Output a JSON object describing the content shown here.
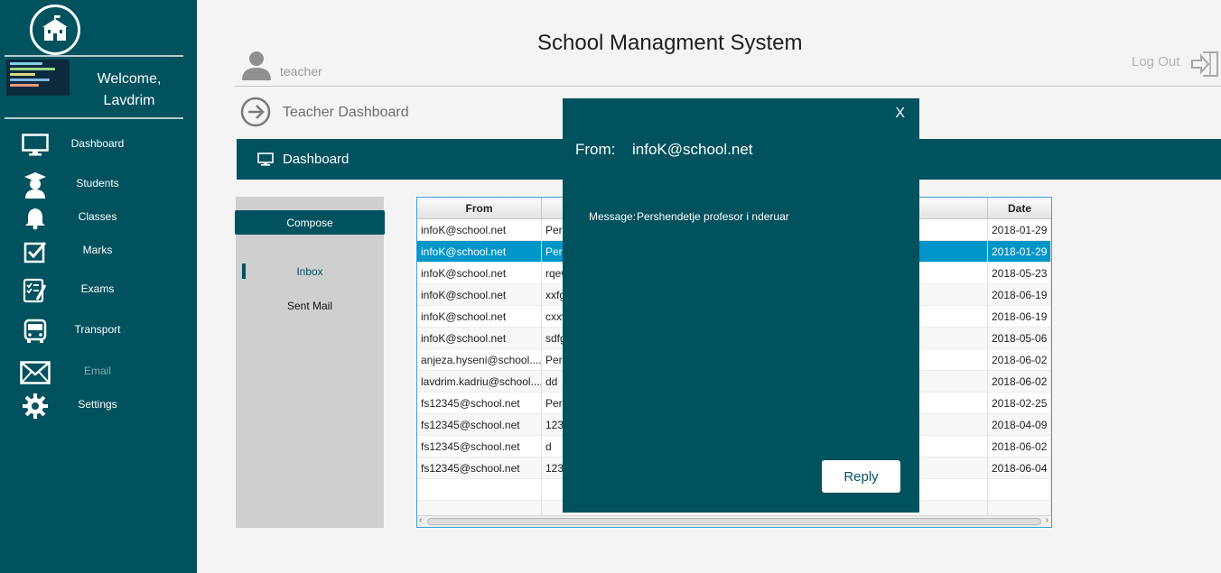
{
  "app": {
    "title": "School Managment System"
  },
  "user": {
    "name": "teacher",
    "welcome_line1": "Welcome,",
    "welcome_line2": "Lavdrim"
  },
  "header": {
    "logout_label": "Log Out",
    "breadcrumb": "Teacher Dashboard",
    "section_title": "Dashboard"
  },
  "sidebar": {
    "items": [
      {
        "label": "Dashboard",
        "icon": "monitor-icon"
      },
      {
        "label": "Students",
        "icon": "graduate-icon"
      },
      {
        "label": "Classes",
        "icon": "bell-icon"
      },
      {
        "label": "Marks",
        "icon": "checkbox-icon"
      },
      {
        "label": "Exams",
        "icon": "exam-checklist-icon"
      },
      {
        "label": "Transport",
        "icon": "bus-icon"
      },
      {
        "label": "Email",
        "icon": "envelope-icon",
        "active": true
      },
      {
        "label": "Settings",
        "icon": "gear-icon"
      }
    ]
  },
  "mail": {
    "compose_label": "Compose",
    "inbox_label": "Inbox",
    "sent_label": "Sent Mail"
  },
  "table": {
    "columns": [
      "From",
      "Date"
    ],
    "selected_index": 1,
    "rows": [
      {
        "from": "infoK@school.net",
        "subject": "Pers",
        "date": "2018-01-29"
      },
      {
        "from": "infoK@school.net",
        "subject": "Pers",
        "date": "2018-01-29"
      },
      {
        "from": "infoK@school.net",
        "subject": "rqew",
        "date": "2018-05-23"
      },
      {
        "from": "infoK@school.net",
        "subject": "xxfg",
        "date": "2018-06-19"
      },
      {
        "from": "infoK@school.net",
        "subject": "cxxv",
        "date": "2018-06-19"
      },
      {
        "from": "infoK@school.net",
        "subject": "sdfg",
        "date": "2018-05-06"
      },
      {
        "from": "anjeza.hyseni@school....",
        "subject": "Pers",
        "date": "2018-06-02"
      },
      {
        "from": "lavdrim.kadriu@school....",
        "subject": "dd",
        "date": "2018-06-02"
      },
      {
        "from": "fs12345@school.net",
        "subject": "Pers",
        "date": "2018-02-25"
      },
      {
        "from": "fs12345@school.net",
        "subject": "123",
        "date": "2018-04-09"
      },
      {
        "from": "fs12345@school.net",
        "subject": "d",
        "date": "2018-06-02"
      },
      {
        "from": "fs12345@school.net",
        "subject": "123",
        "date": "2018-06-04"
      },
      {
        "from": "",
        "subject": "",
        "date": ""
      },
      {
        "from": "",
        "subject": "",
        "date": ""
      }
    ]
  },
  "modal": {
    "close_label": "X",
    "from_label": "From:",
    "from_value": "infoK@school.net",
    "message_label": "Message:",
    "message_value": "Pershendetje profesor i nderuar",
    "reply_label": "Reply"
  },
  "colors": {
    "primary": "#00525f",
    "selection": "#0096c9",
    "sidebar_text": "#ffffff"
  }
}
